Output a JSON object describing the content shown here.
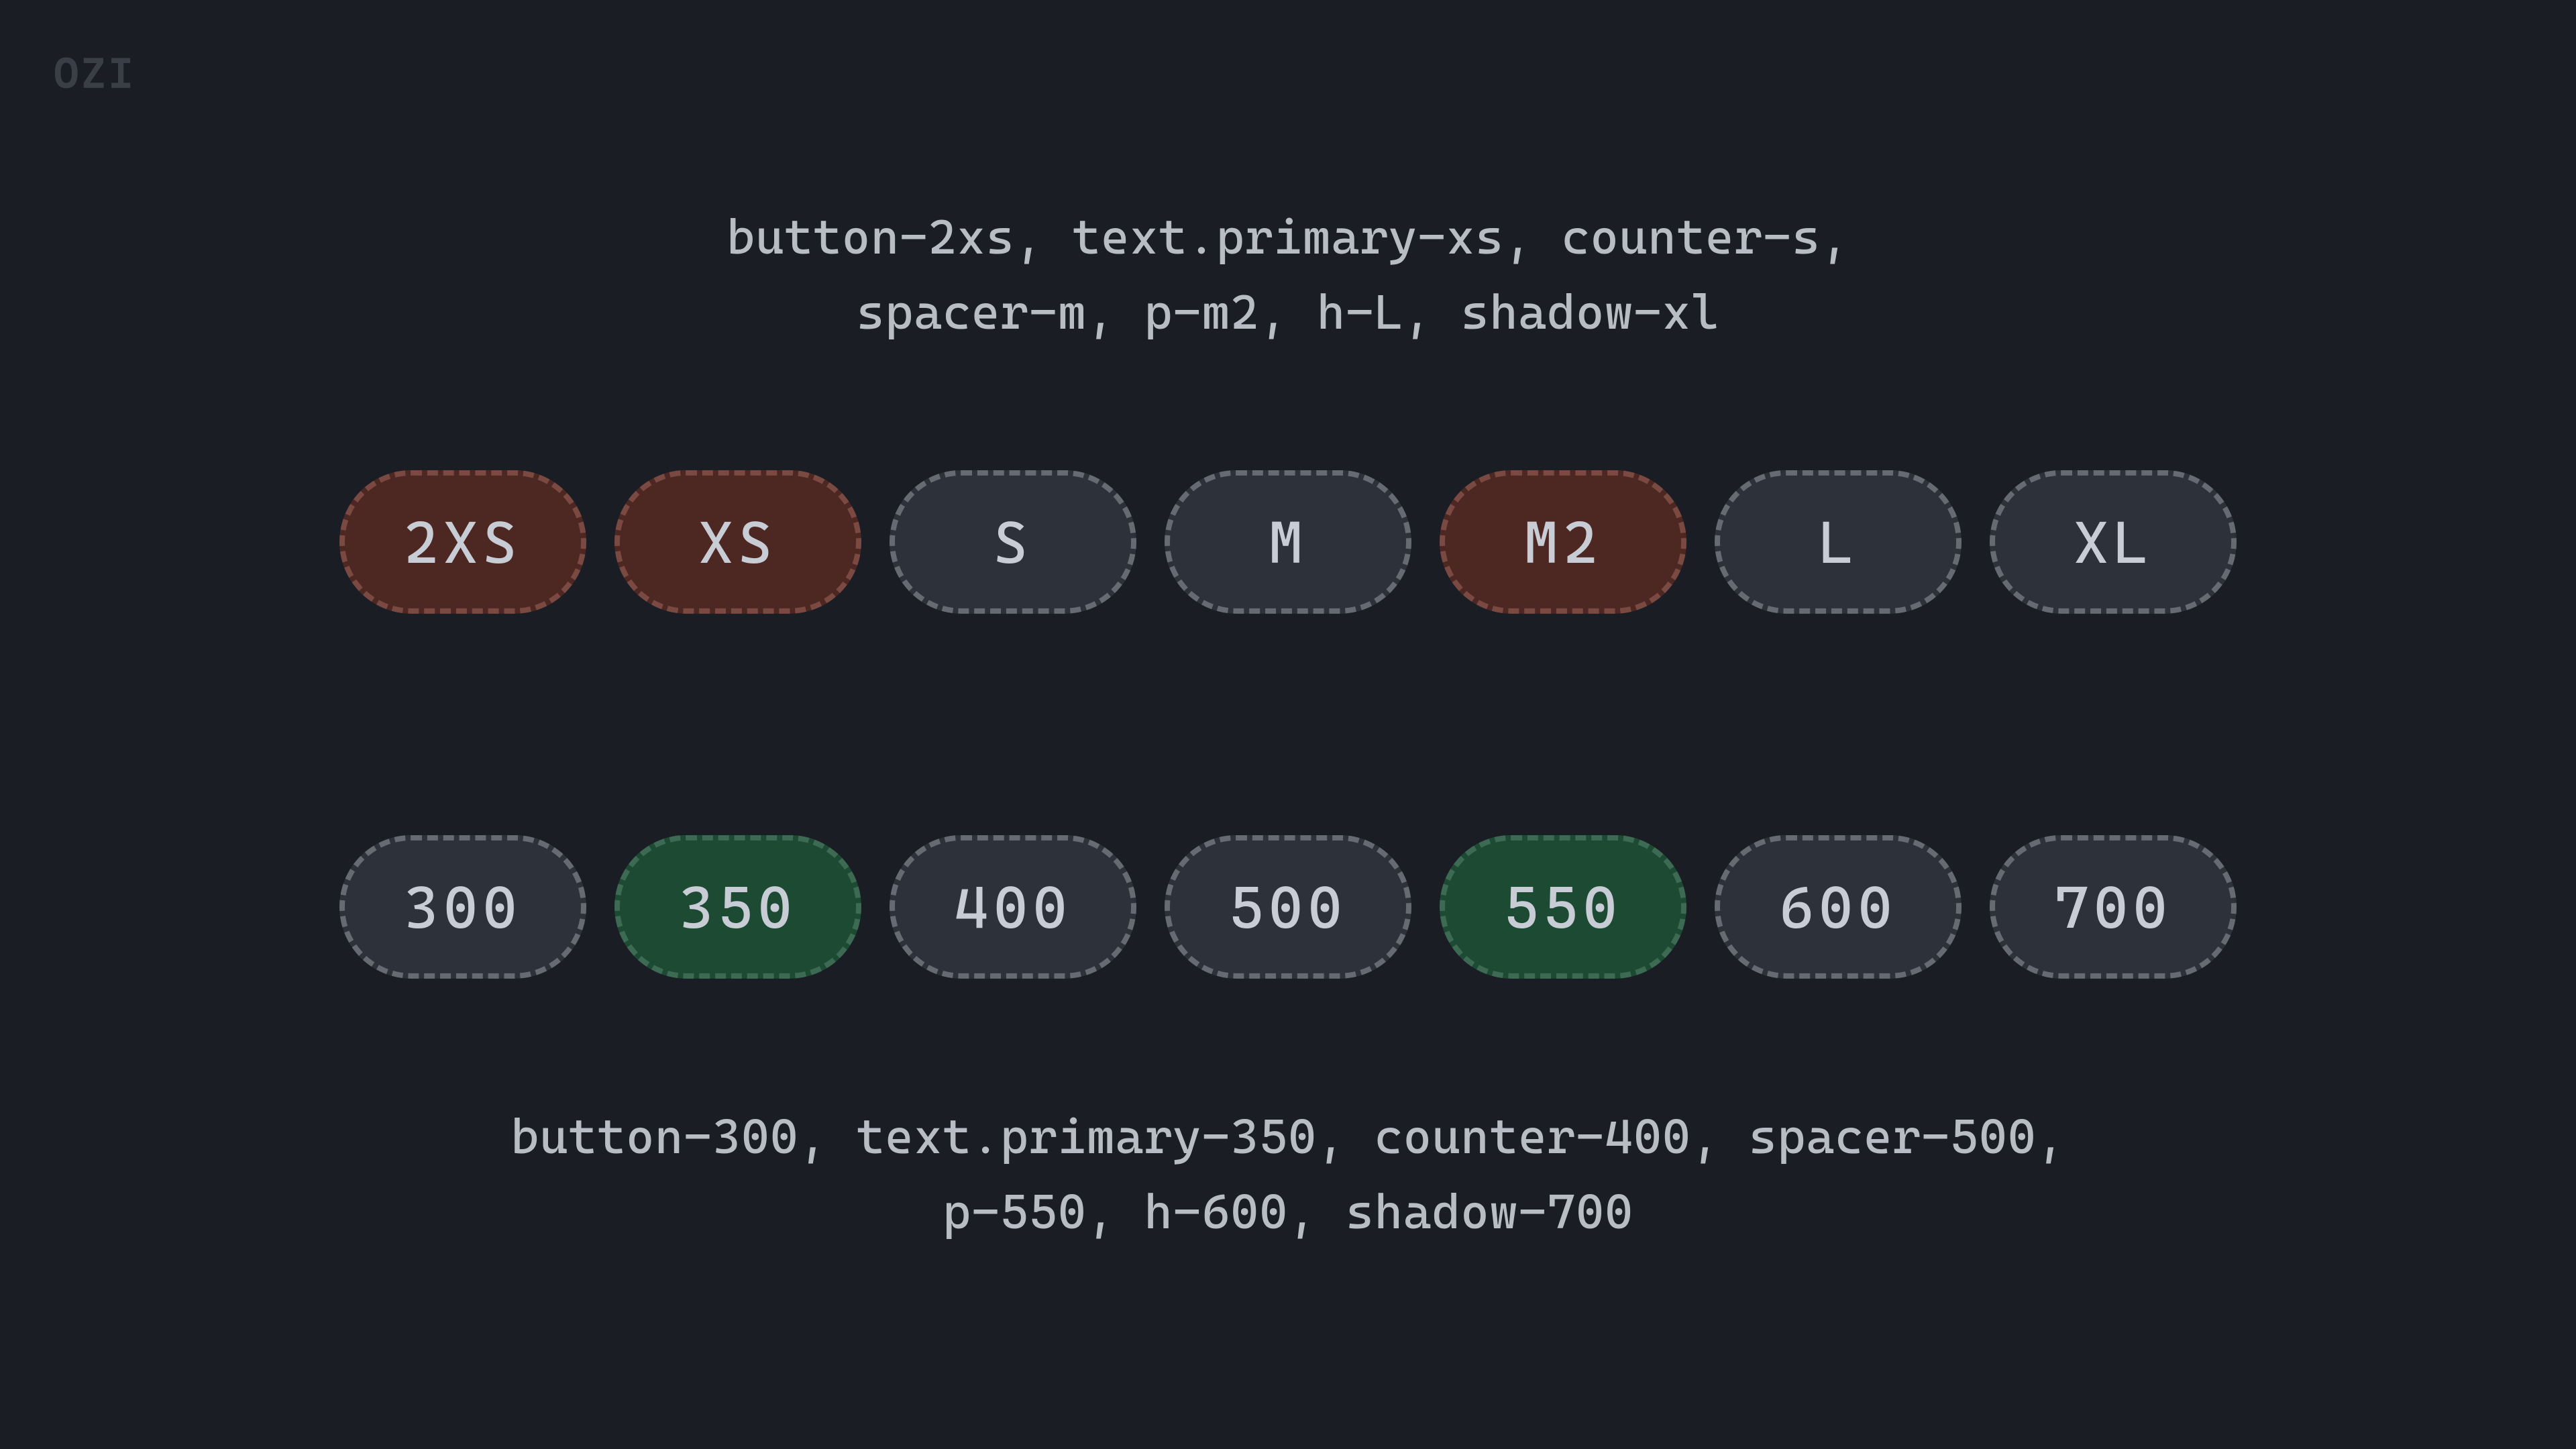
{
  "logo": "OZI",
  "top_label_line1": "button-2xs, text.primary-xs, counter-s,",
  "top_label_line2": "spacer-m, p-m2, h-L, shadow-xl",
  "bottom_label_line1": "button-300, text.primary-350, counter-400, spacer-500,",
  "bottom_label_line2": "p-550, h-600, shadow-700",
  "row_top": {
    "pills": [
      {
        "label": "2XS",
        "variant": "red"
      },
      {
        "label": "XS",
        "variant": "red"
      },
      {
        "label": "S",
        "variant": "neutral"
      },
      {
        "label": "M",
        "variant": "neutral"
      },
      {
        "label": "M2",
        "variant": "red"
      },
      {
        "label": "L",
        "variant": "neutral"
      },
      {
        "label": "XL",
        "variant": "neutral"
      }
    ]
  },
  "row_bottom": {
    "pills": [
      {
        "label": "300",
        "variant": "neutral"
      },
      {
        "label": "350",
        "variant": "green"
      },
      {
        "label": "400",
        "variant": "neutral"
      },
      {
        "label": "500",
        "variant": "neutral"
      },
      {
        "label": "550",
        "variant": "green"
      },
      {
        "label": "600",
        "variant": "neutral"
      },
      {
        "label": "700",
        "variant": "neutral"
      }
    ]
  }
}
